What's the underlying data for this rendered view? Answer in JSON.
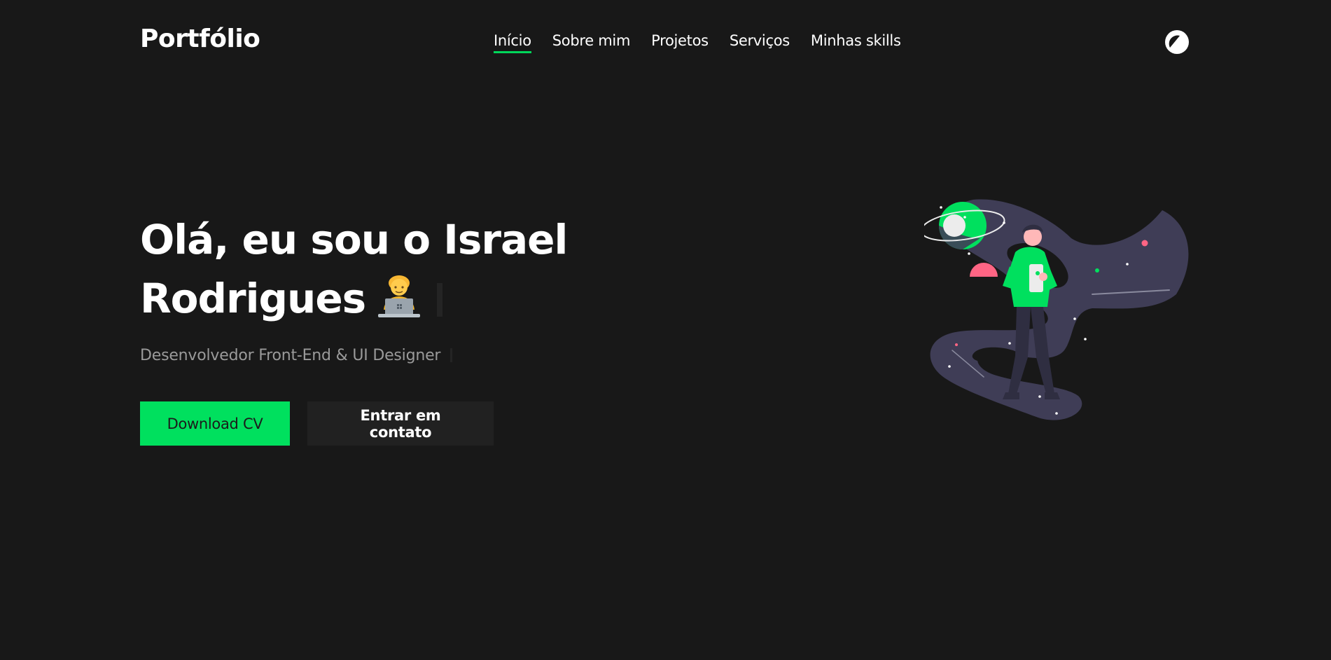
{
  "header": {
    "logo": "Portfólio",
    "nav": [
      {
        "label": "Início",
        "active": true
      },
      {
        "label": "Sobre mim",
        "active": false
      },
      {
        "label": "Projetos",
        "active": false
      },
      {
        "label": "Serviços",
        "active": false
      },
      {
        "label": "Minhas skills",
        "active": false
      }
    ],
    "theme_toggle_icon": "contrast-icon"
  },
  "hero": {
    "title_line1": "Olá, eu sou o Israel",
    "title_line2": "Rodrigues",
    "emoji": "technologist-emoji",
    "subtitle": "Desenvolvedor Front-End & UI Designer",
    "primary_button": "Download CV",
    "secondary_button": "Entrar em contato"
  },
  "illustration": {
    "name": "person-in-space-illustration"
  },
  "colors": {
    "background": "#181818",
    "accent": "#00e05e",
    "text": "#ffffff",
    "muted_text": "#9a9a9a",
    "secondary_button_bg": "#212121",
    "space_purple": "#3f3d56",
    "planet_pink": "#ff6584"
  }
}
